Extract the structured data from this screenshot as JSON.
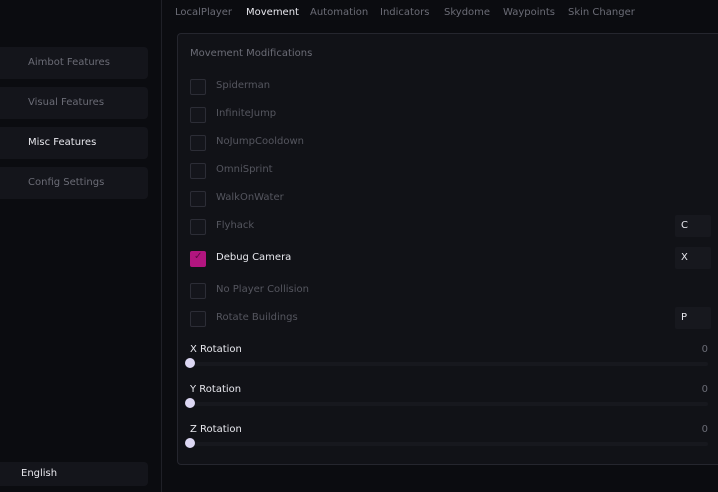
{
  "sidebar": {
    "items": [
      {
        "label": "Aimbot Features",
        "active": false
      },
      {
        "label": "Visual Features",
        "active": false
      },
      {
        "label": "Misc Features",
        "active": true
      },
      {
        "label": "Config Settings",
        "active": false
      }
    ],
    "language": "English"
  },
  "tabs": [
    "LocalPlayer",
    "Movement",
    "Automation",
    "Indicators",
    "Skydome",
    "Waypoints",
    "Skin Changer"
  ],
  "active_tab": "Movement",
  "panel": {
    "title": "Movement Modifications",
    "options": [
      {
        "label": "Spiderman",
        "checked": false
      },
      {
        "label": "InfiniteJump",
        "checked": false
      },
      {
        "label": "NoJumpCooldown",
        "checked": false
      },
      {
        "label": "OmniSprint",
        "checked": false
      },
      {
        "label": "WalkOnWater",
        "checked": false
      },
      {
        "label": "Flyhack",
        "checked": false,
        "key": "C"
      },
      {
        "label": "Debug Camera",
        "checked": true,
        "key": "X"
      },
      {
        "label": "No Player Collision",
        "checked": false
      },
      {
        "label": "Rotate Buildings",
        "checked": false,
        "key": "P"
      }
    ],
    "sliders": [
      {
        "label": "X Rotation",
        "value": "0",
        "fraction": 0
      },
      {
        "label": "Y Rotation",
        "value": "0",
        "fraction": 0
      },
      {
        "label": "Z Rotation",
        "value": "0",
        "fraction": 0
      }
    ]
  },
  "colors": {
    "accent": "#b2157f",
    "background": "#0b0c10",
    "panel": "#111217",
    "thumb": "#ddd8f4"
  }
}
